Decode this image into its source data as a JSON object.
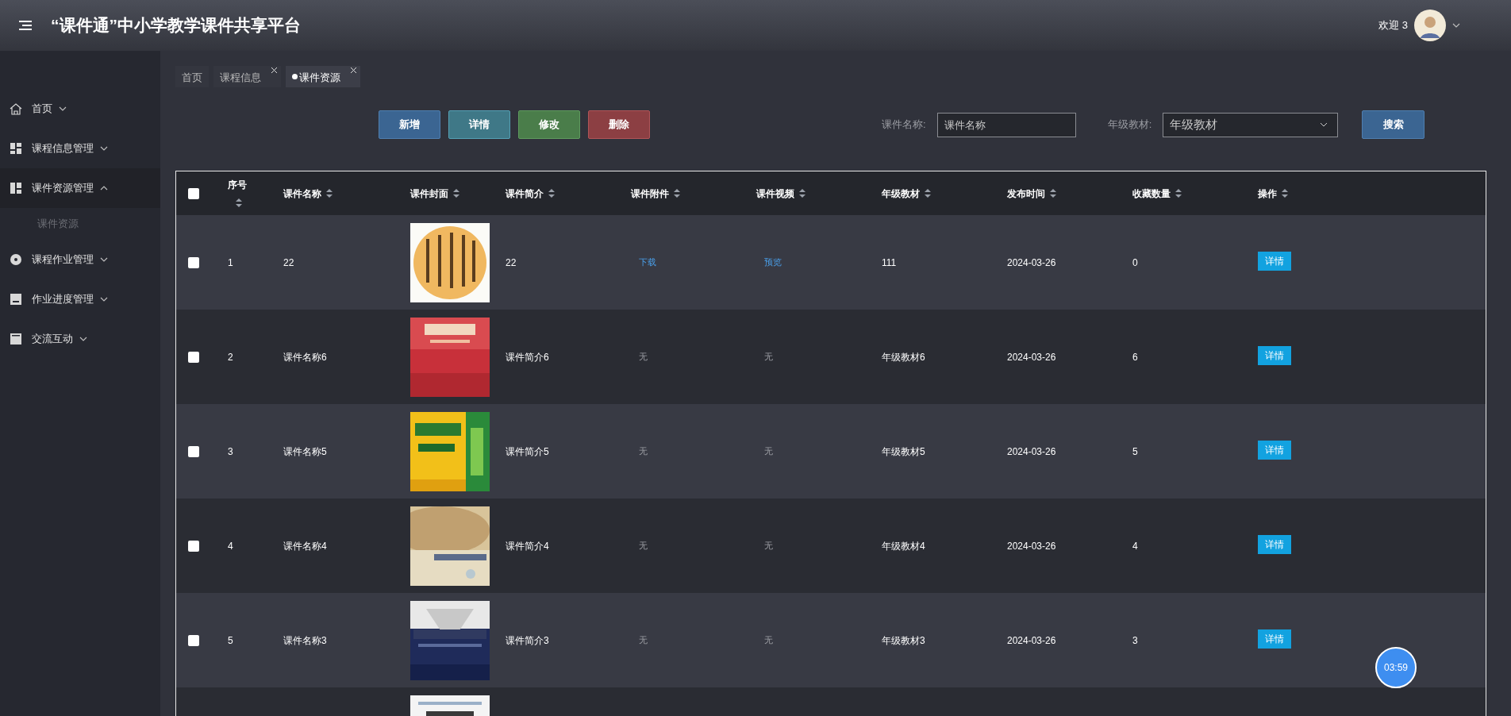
{
  "header": {
    "title": "“课件通”中小学教学课件共享平台",
    "welcome": "欢迎 3"
  },
  "sidebar": {
    "items": [
      {
        "label": "首页",
        "expanded": false
      },
      {
        "label": "课程信息管理",
        "expanded": false
      },
      {
        "label": "课件资源管理",
        "expanded": true,
        "children": [
          {
            "label": "课件资源",
            "selected": false
          }
        ]
      },
      {
        "label": "课程作业管理",
        "expanded": false
      },
      {
        "label": "作业进度管理",
        "expanded": false
      },
      {
        "label": "交流互动",
        "expanded": false
      }
    ]
  },
  "tabs": [
    {
      "label": "首页",
      "closable": false,
      "selected": false
    },
    {
      "label": "课程信息",
      "closable": true,
      "selected": false
    },
    {
      "label": "课件资源",
      "closable": true,
      "selected": true
    }
  ],
  "toolbar": {
    "buttons": [
      {
        "label": "新增",
        "kind": "add"
      },
      {
        "label": "详情",
        "kind": "detail"
      },
      {
        "label": "修改",
        "kind": "edit"
      },
      {
        "label": "删除",
        "kind": "delete"
      }
    ],
    "name_label": "课件名称:",
    "name_placeholder": "课件名称",
    "grade_label": "年级教材:",
    "grade_value": "年级教材",
    "search": "搜索"
  },
  "table": {
    "select_all_checked": false,
    "columns": [
      "序号",
      "课件名称",
      "课件封面",
      "课件简介",
      "课件附件",
      "课件视频",
      "年级教材",
      "发布时间",
      "收藏数量",
      "操作"
    ],
    "rows": [
      {
        "checked": false,
        "index": "1",
        "name": "22",
        "cover": {
          "kind": "picture"
        },
        "intro": "22",
        "attachment": {
          "text": "下载",
          "kind": "link"
        },
        "video": {
          "text": "预览",
          "kind": "link"
        },
        "grade": "111",
        "date": "2024-03-26",
        "favorites": "0",
        "action": "详情"
      },
      {
        "checked": false,
        "index": "2",
        "name": "课件名称6",
        "cover": {
          "kind": "picture"
        },
        "intro": "课件简介6",
        "attachment": {
          "text": "无",
          "kind": "none"
        },
        "video": {
          "text": "无",
          "kind": "none"
        },
        "grade": "年级教材6",
        "date": "2024-03-26",
        "favorites": "6",
        "action": "详情"
      },
      {
        "checked": false,
        "index": "3",
        "name": "课件名称5",
        "cover": {
          "kind": "picture"
        },
        "intro": "课件简介5",
        "attachment": {
          "text": "无",
          "kind": "none"
        },
        "video": {
          "text": "无",
          "kind": "none"
        },
        "grade": "年级教材5",
        "date": "2024-03-26",
        "favorites": "5",
        "action": "详情"
      },
      {
        "checked": false,
        "index": "4",
        "name": "课件名称4",
        "cover": {
          "kind": "picture"
        },
        "intro": "课件简介4",
        "attachment": {
          "text": "无",
          "kind": "none"
        },
        "video": {
          "text": "无",
          "kind": "none"
        },
        "grade": "年级教材4",
        "date": "2024-03-26",
        "favorites": "4",
        "action": "详情"
      },
      {
        "checked": false,
        "index": "5",
        "name": "课件名称3",
        "cover": {
          "kind": "picture"
        },
        "intro": "课件简介3",
        "attachment": {
          "text": "无",
          "kind": "none"
        },
        "video": {
          "text": "无",
          "kind": "none"
        },
        "grade": "年级教材3",
        "date": "2024-03-26",
        "favorites": "3",
        "action": "详情"
      },
      {
        "cover": {
          "kind": "picture"
        }
      }
    ]
  },
  "timer_badge": "03:59"
}
